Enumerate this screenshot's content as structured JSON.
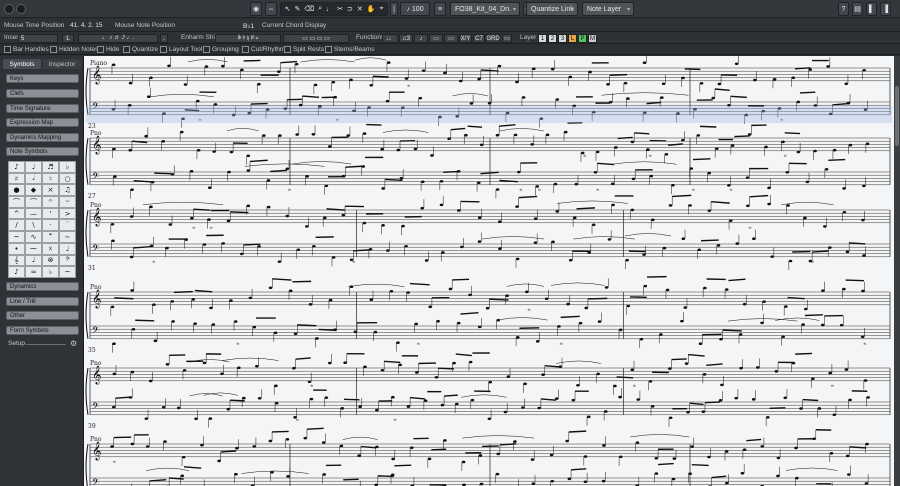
{
  "toolbar": {
    "icons": [
      "record-icon",
      "settings-icon"
    ],
    "zoom_value": "100",
    "part_name": "FO38_Kit_04_Dn.",
    "quantize_link": "Quantize Link",
    "layer_select": "Note Layer"
  },
  "info": {
    "mouse_time_label": "Mouse Time Position",
    "mouse_time_value": "41.  4.  2.  15",
    "mouse_note_label": "Mouse Note Position",
    "mouse_note_value": "B♭1",
    "chord_label": "Current Chord Display",
    "insert_label": "Insert",
    "insert_value": "5",
    "enharm_label": "Enharm Shift",
    "functions_label": "Functions",
    "layer_label": "Layer",
    "layer_buttons": [
      "1",
      "2",
      "3",
      "L",
      "P",
      "M"
    ],
    "function_buttons": [
      "X/Y",
      "C7",
      "GRD"
    ]
  },
  "filters": [
    "Bar Handles",
    "Hidden Notes",
    "Hide",
    "Quantize",
    "Layout Tool",
    "Grouping",
    "Cut/Rhythm",
    "Split Rests",
    "Stems/Beams"
  ],
  "zone": {
    "tabs": [
      "Symbols",
      "Inspector"
    ],
    "sections_top": [
      "Keys",
      "Clefs",
      "Time Signature",
      "Expression Map",
      "Dynamics Mapping",
      "Note Symbols"
    ],
    "sections_bottom": [
      "Dynamics",
      "Line / Trill",
      "Other",
      "Form Symbols"
    ],
    "setup_label": "Setup",
    "palette": [
      "♪",
      "♩",
      "♬",
      "♭",
      "♯",
      "𝅗𝅥",
      "♮",
      "○",
      "●",
      "◆",
      "×",
      "♫",
      "⌒",
      "⌒",
      "𝄐",
      "𝄑",
      "^",
      "—",
      "'",
      ">",
      "/",
      "\\",
      "·",
      "¨",
      "~",
      "∿",
      "𝄌",
      "∼",
      "•",
      "⁓",
      "☓",
      "♩",
      "𝄞",
      "♩",
      "⊗",
      "𝄢",
      "♪",
      "≈",
      "♭",
      "~"
    ]
  },
  "score": {
    "instrument_first": "Piano",
    "instrument_abbrev": "Pno",
    "systems": [
      {
        "label": "Piano",
        "measure_number": "23"
      },
      {
        "label": "Pno",
        "measure_number": "27"
      },
      {
        "label": "Pno",
        "measure_number": "31"
      },
      {
        "label": "Pno",
        "measure_number": "35"
      },
      {
        "label": "Pno",
        "measure_number": "39"
      },
      {
        "label": "Pno",
        "measure_number": "43"
      }
    ]
  }
}
